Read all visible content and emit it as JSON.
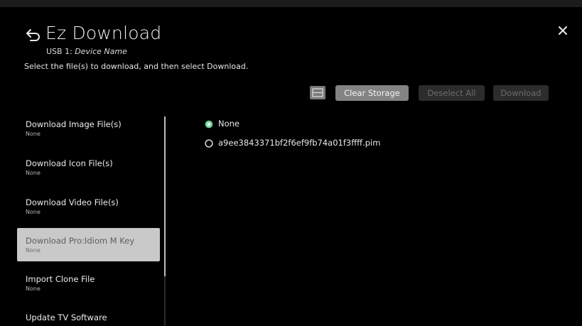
{
  "header": {
    "title": "Ez Download",
    "usb_prefix": "USB 1: ",
    "device_name": "Device Name",
    "instruction": "Select the file(s) to download, and then select Download."
  },
  "toolbar": {
    "clear_storage": "Clear Storage",
    "deselect_all": "Deselect All",
    "download": "Download"
  },
  "sidebar": {
    "items": [
      {
        "label": "Download Image File(s)",
        "value": "None"
      },
      {
        "label": "Download Icon File(s)",
        "value": "None"
      },
      {
        "label": "Download Video File(s)",
        "value": "None"
      },
      {
        "label": "Download Pro:Idiom M Key",
        "value": "None",
        "selected": true
      },
      {
        "label": "Import Clone File",
        "value": "None"
      },
      {
        "label": "Update TV Software",
        "value": ""
      }
    ]
  },
  "options": [
    {
      "label": "None",
      "checked": true
    },
    {
      "label": "a9ee3843371bf2f6ef9fb74a01f3ffff.pim",
      "checked": false
    }
  ],
  "colors": {
    "accent_green": "#6fd49a",
    "selected_bg": "#c9c9c9",
    "background": "#000000"
  },
  "icons": [
    "back-icon",
    "close-icon",
    "storage-icon",
    "radio-checked-icon",
    "radio-unchecked-icon"
  ]
}
